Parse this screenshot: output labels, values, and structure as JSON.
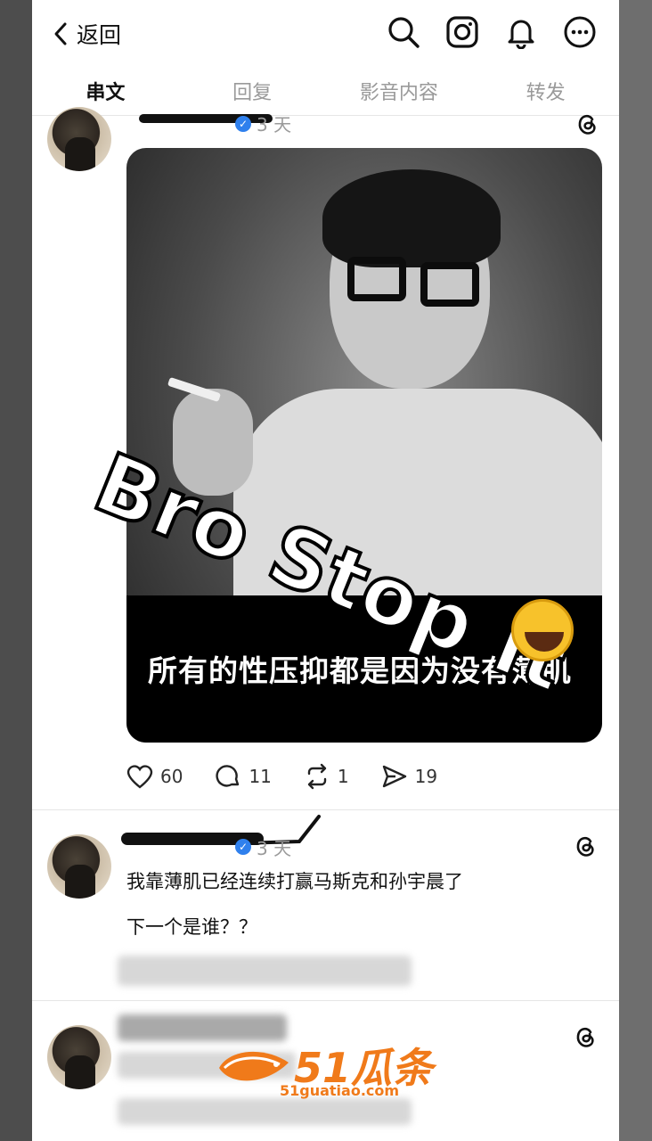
{
  "header": {
    "back_label": "返回",
    "icons": [
      "search-icon",
      "instagram-icon",
      "bell-icon",
      "more-icon"
    ]
  },
  "tabs": [
    {
      "label": "串文",
      "active": true
    },
    {
      "label": "回复",
      "active": false
    },
    {
      "label": "影音内容",
      "active": false
    },
    {
      "label": "转发",
      "active": false
    }
  ],
  "posts": [
    {
      "time": "3 天",
      "image": {
        "overlay_text": "Bro Stop It",
        "caption": "所有的性压抑都是因为没有薄肌"
      },
      "actions": {
        "likes": "60",
        "comments": "11",
        "reposts": "1",
        "shares": "19"
      }
    },
    {
      "time": "3 天",
      "lines": [
        "我靠薄肌已经连续打赢马斯克和孙宇晨了",
        "下一个是谁？？"
      ]
    }
  ],
  "watermark": {
    "main": "51瓜条",
    "sub": "51guatiao.com"
  },
  "colors": {
    "accent_verified": "#2f80ed",
    "watermark": "#f07a1a"
  }
}
